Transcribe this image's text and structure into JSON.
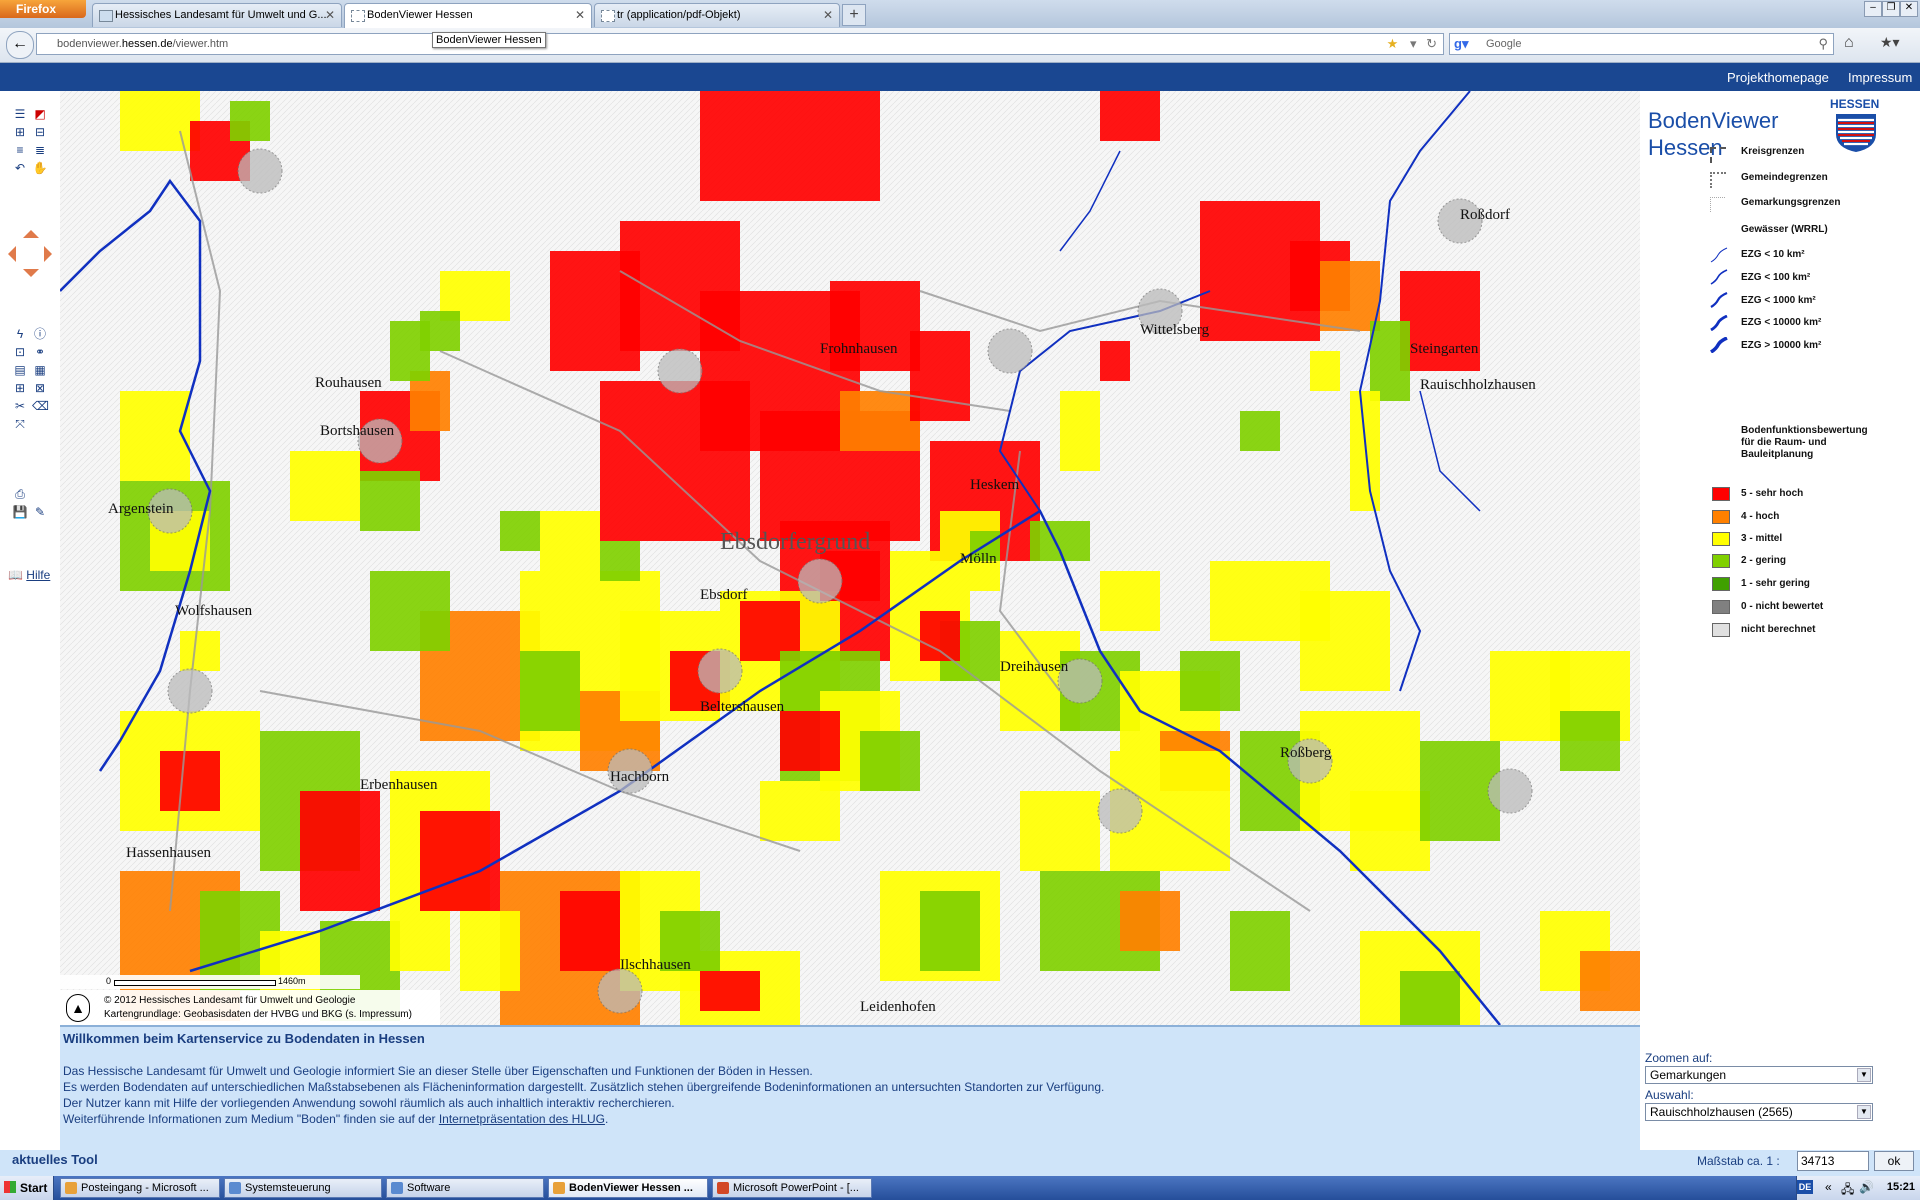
{
  "browser": {
    "menu_button": "Firefox",
    "tabs": [
      {
        "label": "Hessisches Landesamt für Umwelt und G..."
      },
      {
        "label": "BodenViewer Hessen"
      },
      {
        "label": "tr (application/pdf-Objekt)"
      }
    ],
    "url_prefix": "bodenviewer.",
    "url_domain": "hessen.de",
    "url_path": "/viewer.htm",
    "tooltip": "BodenViewer Hessen",
    "search_placeholder": "Google"
  },
  "header": {
    "links": [
      "Projekthomepage",
      "Impressum"
    ]
  },
  "left_tools": {
    "help_label": "Hilfe"
  },
  "map": {
    "scale_start": "0",
    "scale_end": "1460m",
    "copyright": "© 2012 Hessisches Landesamt für Umwelt und Geologie",
    "base_map": "Kartengrundlage: Geobasisdaten der HVBG und BKG (s. Impressum)",
    "place_names": [
      "Rouhausen",
      "Bortshausen",
      "Argenstein",
      "Wolfshausen",
      "Erbenhausen",
      "Hachborn",
      "Ebsdorf",
      "Dreihausen",
      "Roßberg",
      "Rauischholzhausen",
      "Wittelsberg",
      "Roßdorf",
      "Steingarten",
      "Hassenhausen",
      "Ilschhausen",
      "Beltershausen",
      "Ebsdorfergrund",
      "Leidenhofen",
      "Heskem",
      "Mölln",
      "Frohnhausen"
    ]
  },
  "legend": {
    "app_title": "BodenViewer Hessen",
    "state_label": "HESSEN",
    "boundaries": [
      "Kreisgrenzen",
      "Gemeindegrenzen",
      "Gemarkungsgrenzen"
    ],
    "waters_title": "Gewässer (WRRL)",
    "ezg": [
      "EZG < 10 km²",
      "EZG < 100 km²",
      "EZG < 1000 km²",
      "EZG < 10000 km²",
      "EZG > 10000 km²"
    ],
    "rating_title": "Bodenfunktionsbewertung für die Raum- und Bauleitplanung",
    "classes": [
      {
        "label": "5 - sehr hoch",
        "color": "#ff0000"
      },
      {
        "label": "4 - hoch",
        "color": "#ff8000"
      },
      {
        "label": "3 - mittel",
        "color": "#ffff00"
      },
      {
        "label": "2 - gering",
        "color": "#80d000"
      },
      {
        "label": "1 - sehr gering",
        "color": "#40a000"
      },
      {
        "label": "0 - nicht bewertet",
        "color": "#808080"
      },
      {
        "label": "nicht berechnet",
        "color": "#e0e0e0"
      }
    ]
  },
  "info": {
    "heading": "Willkommen beim Kartenservice zu Bodendaten in Hessen",
    "lines": [
      "Das Hessische Landesamt für Umwelt und Geologie informiert Sie an dieser Stelle über Eigenschaften und Funktionen der Böden in Hessen.",
      "Es werden Bodendaten auf unterschiedlichen Maßstabsebenen als Flächeninformation dargestellt. Zusätzlich stehen übergreifende Bodeninformationen an untersuchten Standorten zur Verfügung.",
      "Der Nutzer kann mit Hilfe der vorliegenden Anwendung sowohl räumlich als auch inhaltlich interaktiv recherchieren."
    ],
    "last_line_prefix": "Weiterführende Informationen zum Medium \"Boden\" finden sie auf der ",
    "last_line_link": "Internetpräsentation des HLUG",
    "last_line_suffix": "."
  },
  "zoom": {
    "zoom_label": "Zoomen auf:",
    "zoom_value": "Gemarkungen",
    "select_label": "Auswahl:",
    "select_value": "Rauischholzhausen (2565)"
  },
  "status": {
    "tool_label": "aktuelles Tool",
    "scale_label": "Maßstab ca. 1 :",
    "scale_value": "34713",
    "ok": "ok"
  },
  "taskbar": {
    "start": "Start",
    "tasks": [
      "Posteingang - Microsoft ...",
      "Systemsteuerung",
      "Software",
      "BodenViewer Hessen ...",
      "Microsoft PowerPoint - [..."
    ],
    "lang": "DE",
    "clock": "15:21"
  }
}
